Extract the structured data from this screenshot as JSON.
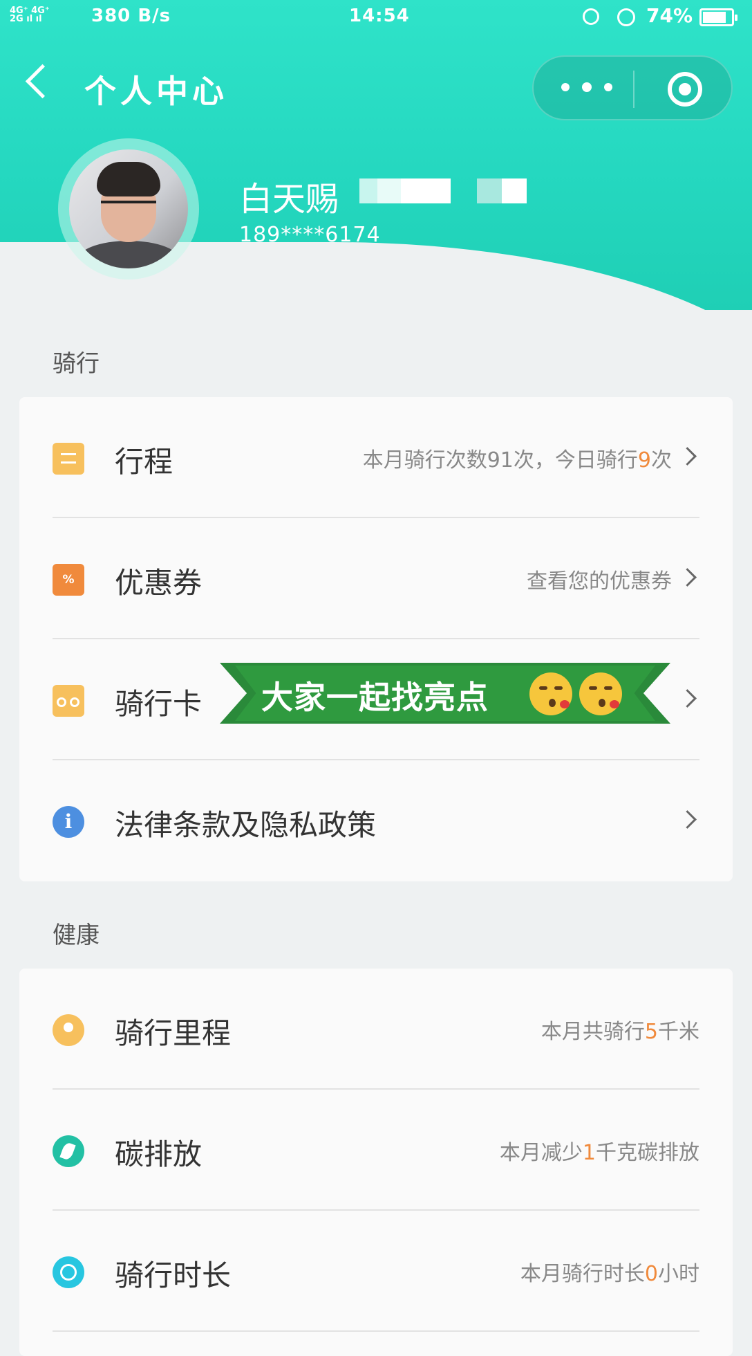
{
  "status_bar": {
    "network": "4G⁺ 4G⁺\n2G",
    "speed": "380 B/s",
    "time": "14:54",
    "battery": "74%",
    "battery_level": 0.74
  },
  "nav": {
    "title": "个人中心"
  },
  "profile": {
    "name": "白天赐",
    "phone": "189****6174"
  },
  "sections": {
    "riding": {
      "label": "骑行",
      "items": [
        {
          "title": "行程",
          "desc_pre": "本月骑行次数91次，今日骑行",
          "desc_hl": "9",
          "desc_post": "次"
        },
        {
          "title": "优惠券",
          "desc": "查看您的优惠券"
        },
        {
          "title": "骑行卡"
        },
        {
          "title": "法律条款及隐私政策"
        }
      ]
    },
    "health": {
      "label": "健康",
      "items": [
        {
          "title": "骑行里程",
          "desc_pre": "本月共骑行",
          "desc_hl": "5",
          "desc_post": "千米"
        },
        {
          "title": "碳排放",
          "desc_pre": "本月减少",
          "desc_hl": "1",
          "desc_post": "千克碳排放"
        },
        {
          "title": "骑行时长",
          "desc_pre": "本月骑行时长",
          "desc_hl": "0",
          "desc_post": "小时"
        }
      ]
    }
  },
  "overlay_banner": {
    "text": "大家一起找亮点",
    "color": "#2f9a3f"
  },
  "colors": {
    "header": "#25d8c0",
    "highlight": "#f08a3c"
  }
}
